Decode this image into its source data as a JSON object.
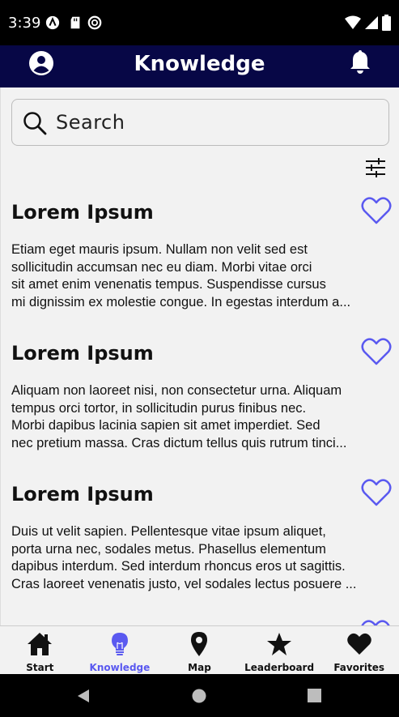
{
  "status_bar": {
    "time": "3:39",
    "left_icons": [
      "app-a-icon",
      "sd-card-icon",
      "dnd-icon"
    ],
    "right_icons": [
      "wifi-icon",
      "signal-icon",
      "battery-icon"
    ]
  },
  "app_bar": {
    "title": "Knowledge",
    "left_icon": "account-icon",
    "right_icon": "notification-bell-icon",
    "background": "#070746"
  },
  "search": {
    "placeholder": "Search"
  },
  "filter_icon": "filter-sliders-icon",
  "articles": [
    {
      "title": "Lorem Ipsum",
      "lines": [
        "Etiam eget mauris ipsum. Nullam non velit sed est",
        "sollicitudin accumsan nec eu diam. Morbi vitae orci",
        "sit amet enim venenatis tempus. Suspendisse cursus",
        "mi dignissim ex molestie congue. In egestas interdum a..."
      ]
    },
    {
      "title": "Lorem Ipsum",
      "lines": [
        "Aliquam non laoreet nisi, non consectetur urna. Aliquam",
        "tempus orci tortor, in sollicitudin purus finibus nec.",
        "Morbi dapibus lacinia sapien sit amet imperdiet. Sed",
        "nec pretium massa. Cras dictum tellus quis rutrum tinci..."
      ]
    },
    {
      "title": "Lorem Ipsum",
      "lines": [
        "Duis ut velit sapien. Pellentesque vitae ipsum aliquet,",
        "porta urna nec, sodales metus. Phasellus elementum",
        "dapibus interdum. Sed interdum rhoncus eros ut sagittis.",
        "Cras laoreet venenatis justo, vel sodales lectus posuere ..."
      ]
    }
  ],
  "accent_color": "#5a59f0",
  "bottom_nav": [
    {
      "label": "Start",
      "icon": "home-icon",
      "active": false
    },
    {
      "label": "Knowledge",
      "icon": "lightbulb-icon",
      "active": true
    },
    {
      "label": "Map",
      "icon": "map-pin-icon",
      "active": false
    },
    {
      "label": "Leaderboard",
      "icon": "star-icon",
      "active": false
    },
    {
      "label": "Favorites",
      "icon": "heart-filled-icon",
      "active": false
    }
  ],
  "system_nav": [
    "back-icon",
    "home-circle-icon",
    "recents-icon"
  ]
}
